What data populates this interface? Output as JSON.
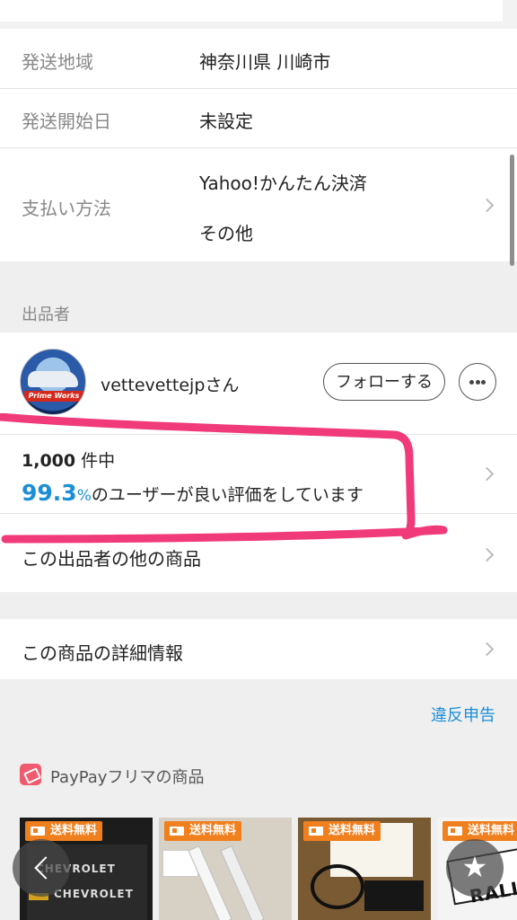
{
  "shipping": {
    "region_label": "発送地域",
    "region_value": "神奈川県 川崎市",
    "start_label": "発送開始日",
    "start_value": "未設定",
    "payment_label": "支払い方法",
    "payment_methods": [
      "Yahoo!かんたん決済",
      "その他"
    ]
  },
  "seller": {
    "section_label": "出品者",
    "name": "vettevettejpさん",
    "avatar_banner": "Prime Works",
    "follow_label": "フォローする",
    "more_icon": "more-horizontal-icon",
    "rating_total": "1,000",
    "rating_total_suffix": " 件中",
    "rating_percent": "99.3",
    "rating_percent_sign": "%",
    "rating_text": "のユーザーが良い評価をしています",
    "other_items_label": "この出品者の他の商品"
  },
  "item_detail_label": "この商品の詳細情報",
  "report_label": "違反申告",
  "paypay": {
    "title": "PayPayフリマの商品",
    "icon": "paypay-flea-market-icon",
    "badge_label": "送料無料",
    "thumb1_text": [
      "CHEVROLET",
      "CHEVROLET"
    ],
    "thumb4_text": "RALLI"
  },
  "nav": {
    "back_icon": "chevron-left-icon",
    "favorite_icon": "star-icon",
    "favorite_glyph": "★"
  },
  "colors": {
    "accent_blue": "#1a8ed8",
    "highlight_pink": "#f03a7a",
    "badge_orange": "#f07f1e"
  }
}
